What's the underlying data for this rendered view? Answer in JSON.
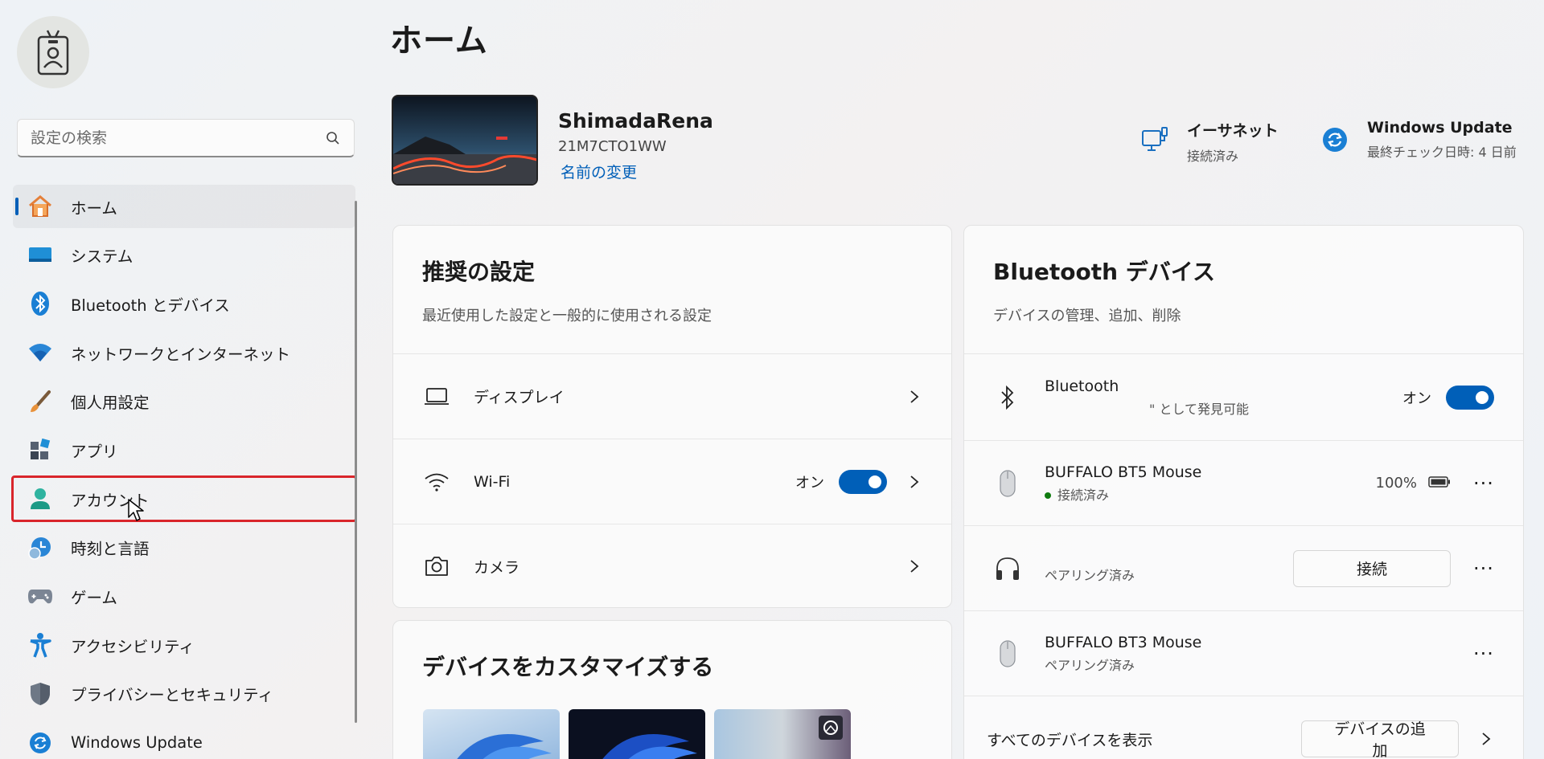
{
  "search": {
    "placeholder": "設定の検索"
  },
  "sidebar": {
    "items": [
      {
        "label": "ホーム",
        "icon": "home-icon"
      },
      {
        "label": "システム",
        "icon": "system-icon"
      },
      {
        "label": "Bluetooth とデバイス",
        "icon": "bluetooth-icon"
      },
      {
        "label": "ネットワークとインターネット",
        "icon": "wifi-icon"
      },
      {
        "label": "個人用設定",
        "icon": "brush-icon"
      },
      {
        "label": "アプリ",
        "icon": "apps-icon"
      },
      {
        "label": "アカウント",
        "icon": "account-icon"
      },
      {
        "label": "時刻と言語",
        "icon": "clock-globe-icon"
      },
      {
        "label": "ゲーム",
        "icon": "gamepad-icon"
      },
      {
        "label": "アクセシビリティ",
        "icon": "accessibility-icon"
      },
      {
        "label": "プライバシーとセキュリティ",
        "icon": "shield-icon"
      },
      {
        "label": "Windows Update",
        "icon": "update-icon"
      }
    ],
    "active_index": 0,
    "highlighted_index": 6
  },
  "page": {
    "title": "ホーム"
  },
  "device": {
    "name": "ShimadaRena",
    "model": "21M7CTO1WW",
    "rename": "名前の変更"
  },
  "status": {
    "ethernet": {
      "title": "イーサネット",
      "sub": "接続済み"
    },
    "update": {
      "title": "Windows Update",
      "sub": "最終チェック日時: 4 日前"
    }
  },
  "recommended": {
    "title": "推奨の設定",
    "subtitle": "最近使用した設定と一般的に使用される設定",
    "rows": [
      {
        "label": "ディスプレイ"
      },
      {
        "label": "Wi-Fi",
        "toggle": "オン"
      },
      {
        "label": "カメラ"
      }
    ]
  },
  "customize": {
    "title": "デバイスをカスタマイズする"
  },
  "bluetooth_card": {
    "title": "Bluetooth デバイス",
    "subtitle": "デバイスの管理、追加、削除",
    "bt_row": {
      "label": "Bluetooth",
      "sub": "\" として発見可能",
      "toggle": "オン"
    },
    "devices": [
      {
        "name": "BUFFALO BT5 Mouse",
        "status": "接続済み",
        "battery": "100%"
      },
      {
        "name": "",
        "status": "ペアリング済み",
        "button": "接続"
      },
      {
        "name": "BUFFALO BT3 Mouse",
        "status": "ペアリング済み"
      }
    ],
    "footer": {
      "show_all": "すべてのデバイスを表示",
      "add": "デバイスの追加"
    }
  },
  "more_glyph": "···",
  "colors": {
    "accent": "#005fb8",
    "highlight": "#d9252b",
    "connected": "#0f7b0f"
  }
}
